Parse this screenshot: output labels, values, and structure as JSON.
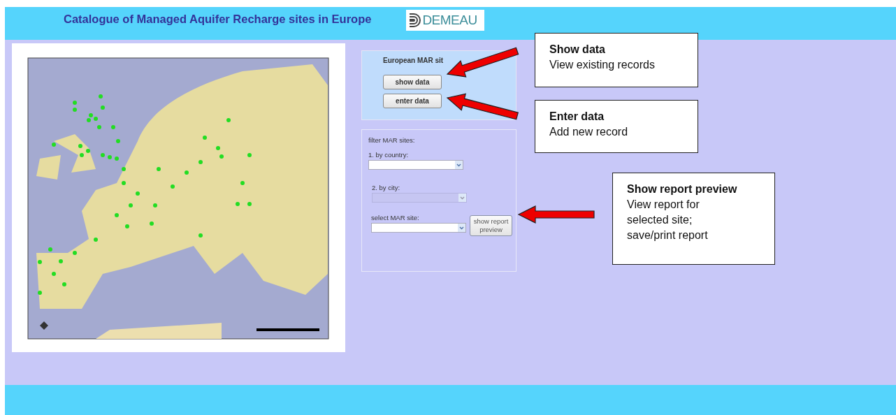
{
  "header": {
    "title": "Catalogue of Managed Aquifer Recharge sites in Europe",
    "logo": "DEMEAU"
  },
  "data_panel": {
    "title": "European MAR sit",
    "buttons": [
      {
        "label": "show data"
      },
      {
        "label": "enter data"
      }
    ]
  },
  "filter_panel": {
    "title": "filter MAR sites:",
    "fields": [
      {
        "label": "1. by country:",
        "disabled": false
      },
      {
        "label": "2. by city:",
        "disabled": true
      },
      {
        "label": "select MAR site:",
        "disabled": false
      }
    ],
    "report_button": "show report preview"
  },
  "callouts": [
    {
      "title": "Show data",
      "text": "View existing records"
    },
    {
      "title": "Enter data",
      "text": "Add new record"
    },
    {
      "title": "Show report preview",
      "text": "View report for\nselected site;\nsave/print report"
    }
  ]
}
